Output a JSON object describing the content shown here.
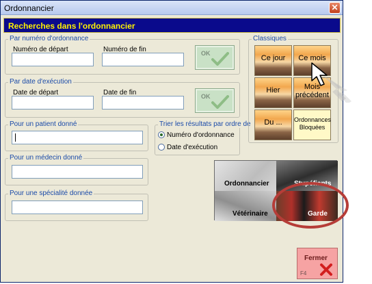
{
  "window": {
    "title": "Ordonnancier",
    "close_glyph": "✕"
  },
  "header": {
    "title": "Recherches dans l'ordonnancier"
  },
  "groups": {
    "numero": {
      "label": "Par numéro d'ordonnance",
      "start_label": "Numéro de départ",
      "end_label": "Numéro de fin",
      "ok_label": "OK"
    },
    "date": {
      "label": "Par date d'exécution",
      "start_label": "Date de départ",
      "end_label": "Date de fin",
      "ok_label": "OK"
    },
    "patient": {
      "label": "Pour un patient donné"
    },
    "medecin": {
      "label": "Pour un médecin donné"
    },
    "specialite": {
      "label": "Pour une spécialité donnée"
    },
    "tri": {
      "label": "Trier les résultats par ordre de",
      "options": [
        "Numéro d'ordonnance",
        "Date d'exécution"
      ],
      "selected": 0
    }
  },
  "classiques": {
    "label": "Classiques",
    "buttons": [
      "Ce jour",
      "Ce mois",
      "Hier",
      "Mois précédent",
      "Du ...",
      "Ordonnances Bloquées"
    ]
  },
  "categories": [
    "Ordonnancier",
    "Stupéfiants",
    "Vétérinaire",
    "Garde"
  ],
  "fermer": {
    "label": "Fermer",
    "shortcut": "F4"
  },
  "icons": {
    "close": "close-icon",
    "check": "check-icon",
    "cursor": "hand-cursor-icon",
    "cross": "red-cross-icon"
  },
  "colors": {
    "header_bg": "#0a0a8c",
    "header_text": "#fff200",
    "group_label": "#1a4aa8",
    "ok_bg": "#c9e1c6",
    "fermer_bg": "#f6a3a3",
    "callout": "#b63d38"
  }
}
